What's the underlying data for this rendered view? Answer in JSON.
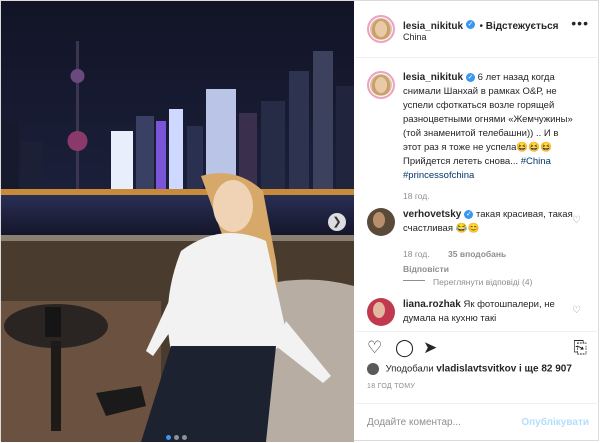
{
  "post": {
    "username": "lesia_nikituk",
    "follow_label": "Відстежується",
    "location": "China",
    "more_label": "•••"
  },
  "caption": {
    "username": "lesia_nikituk",
    "text": "6 лет назад когда снимали Шанхай в рамках О&Р, не успели сфоткаться возле горящей разноцветными огнями «Жемчужины» (той знаменитой телебашни)) .. И в этот раз я тоже не успела😆😆😆Прийдется лететь снова...",
    "hashtags": "#China #princessofchina",
    "time": "18 год."
  },
  "comments": [
    {
      "username": "verhovetsky",
      "text": "такая красивая, такая счастливая 😂😊",
      "time": "18 год.",
      "likes": "35 вподобань",
      "reply": "Відповісти",
      "view_replies": "Переглянути відповіді (4)"
    },
    {
      "username": "liana.rozhak",
      "text": "Як фотошпалери, не думала на кухню такі"
    }
  ],
  "likes_text": {
    "prefix": "Уподобали",
    "user": "vladislavtsvitkov",
    "suffix": "і ще 82 907"
  },
  "timestamp": "18 ГОД ТОМУ",
  "add_comment": {
    "placeholder": "Додайте коментар...",
    "publish": "Опублікувати"
  },
  "icons": {
    "heart": "heart-icon",
    "comment": "comment-icon",
    "share": "share-icon",
    "bookmark": "bookmark-icon"
  },
  "colors": {
    "link_blue": "#3897f0",
    "hashtag": "#003569",
    "publish_disabled": "#b2dffc"
  }
}
